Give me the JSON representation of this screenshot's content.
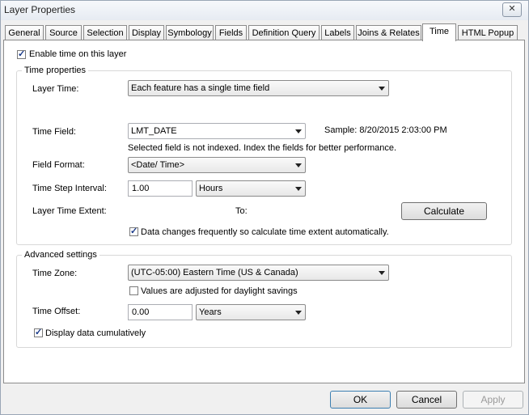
{
  "window": {
    "title": "Layer Properties",
    "close_label": "✕"
  },
  "tabs": [
    "General",
    "Source",
    "Selection",
    "Display",
    "Symbology",
    "Fields",
    "Definition Query",
    "Labels",
    "Joins & Relates",
    "Time",
    "HTML Popup"
  ],
  "enable_time": {
    "label": "Enable time on this layer",
    "checked": true
  },
  "time_properties": {
    "legend": "Time properties",
    "layer_time_label": "Layer Time:",
    "layer_time_value": "Each feature has a single time field",
    "time_field_label": "Time Field:",
    "time_field_value": "LMT_DATE",
    "sample_text": "Sample: 8/20/2015 2:03:00 PM",
    "index_warning": "Selected field is not indexed. Index the fields for better performance.",
    "field_format_label": "Field Format:",
    "field_format_value": "<Date/ Time>",
    "time_step_label": "Time Step Interval:",
    "time_step_value": "1.00",
    "time_step_unit": "Hours",
    "extent_label": "Layer Time Extent:",
    "to_label": "To:",
    "calculate_label": "Calculate",
    "auto_extent": {
      "label": "Data changes frequently so calculate time extent automatically.",
      "checked": true
    }
  },
  "advanced": {
    "legend": "Advanced settings",
    "time_zone_label": "Time Zone:",
    "time_zone_value": "(UTC-05:00) Eastern Time (US & Canada)",
    "daylight": {
      "label": "Values are adjusted for daylight savings",
      "checked": false
    },
    "offset_label": "Time Offset:",
    "offset_value": "0.00",
    "offset_unit": "Years",
    "cumulative": {
      "label": "Display data cumulatively",
      "checked": true
    }
  },
  "buttons": {
    "ok": "OK",
    "cancel": "Cancel",
    "apply": "Apply"
  }
}
